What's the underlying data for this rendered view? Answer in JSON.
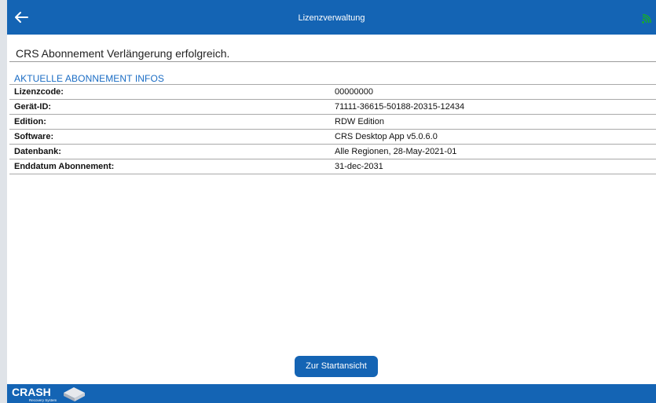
{
  "header": {
    "title": "Lizenzverwaltung",
    "back_icon": "arrow-left-icon",
    "status_icon": "signal-icon",
    "color": "#1464b4",
    "status_icon_color": "#17b51c"
  },
  "status": {
    "message": "CRS Abonnement Verlängerung erfolgreich."
  },
  "section": {
    "title": "AKTUELLE ABONNEMENT INFOS",
    "title_color": "#1a6cc4"
  },
  "info_rows": [
    {
      "label": "Lizenzcode:",
      "value": "00000000"
    },
    {
      "label": "Gerät-ID:",
      "value": "71111-36615-50188-20315-12434"
    },
    {
      "label": "Edition:",
      "value": "RDW Edition"
    },
    {
      "label": "Software:",
      "value": "CRS Desktop App v5.0.6.0"
    },
    {
      "label": "Datenbank:",
      "value": "Alle Regionen, 28-May-2021-01"
    },
    {
      "label": "Enddatum Abonnement:",
      "value": "31-dec-2031"
    }
  ],
  "actions": {
    "start_label": "Zur Startansicht"
  },
  "footer": {
    "logo_text": "CRASH",
    "logo_subtext": "Recovery System"
  }
}
